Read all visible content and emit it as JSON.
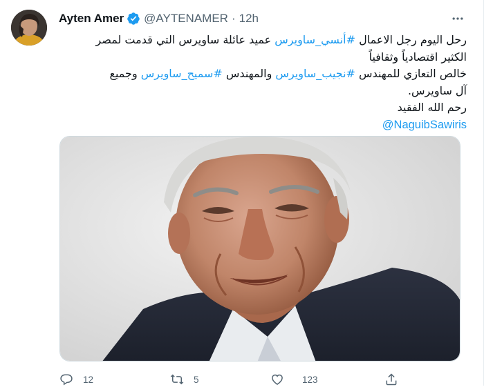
{
  "tweet": {
    "author": {
      "name": "Ayten Amer",
      "handle": "@AYTENAMER",
      "separator": "·",
      "time": "12h",
      "verified": true
    },
    "text": {
      "line1_a": "رحل اليوم رجل الاعمال ",
      "hashtag1": "#أنسي_ساويرس",
      "line1_b": " عميد عائلة ساويرس التي قدمت لمصر",
      "line2": "الكثير اقتصادياً وثقافياً",
      "line3_a": "خالص التعازي للمهندس  ",
      "hashtag2": "#نجيب_ساويرس",
      "line3_b": " والمهندس ",
      "hashtag3": "#سميح_ساويرس",
      "line3_c": " وجميع",
      "line4": "آل ساويرس.",
      "line5": "رحم الله الفقيد",
      "mention": "@NaguibSawiris"
    },
    "actions": {
      "reply_count": "12",
      "retweet_count": "5",
      "like_count": "123"
    },
    "colors": {
      "link": "#1d9bf0",
      "verified_badge": "#1d9bf0",
      "secondary_text": "#536471"
    }
  }
}
